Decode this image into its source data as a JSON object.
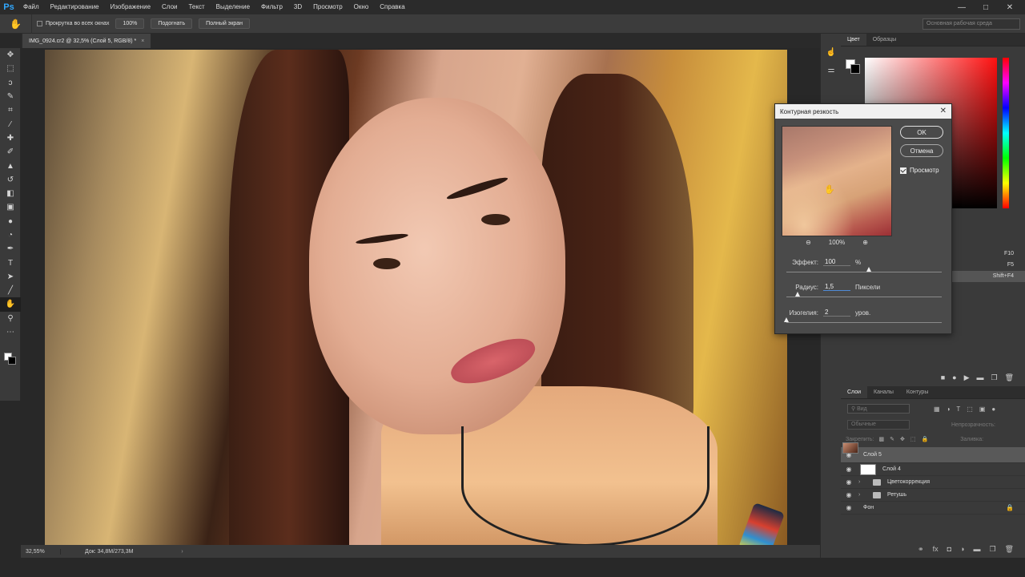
{
  "app": {
    "logo": "Ps"
  },
  "menu": [
    "Файл",
    "Редактирование",
    "Изображение",
    "Слои",
    "Текст",
    "Выделение",
    "Фильтр",
    "3D",
    "Просмотр",
    "Окно",
    "Справка"
  ],
  "window_controls": {
    "minimize": "—",
    "maximize": "□",
    "close": "✕"
  },
  "options_bar": {
    "scroll_all_label": "Прокрутка во всех окнах",
    "zoom_100": "100%",
    "fit_label": "Подогнать",
    "fullscreen_label": "Полный экран",
    "workspace_placeholder": "Основная рабочая среда"
  },
  "document": {
    "tab_title": "IMG_0924.cr2 @ 32,5% (Слой 5, RGB/8) *",
    "tab_close": "×",
    "status_zoom": "32,55%",
    "status_doc": "Док: 34,8M/273,3M",
    "status_arrow": "›"
  },
  "tools": [
    "move",
    "marquee",
    "lasso",
    "quick-select",
    "crop",
    "eyedropper",
    "healing",
    "brush",
    "stamp",
    "history-brush",
    "eraser",
    "gradient",
    "blur",
    "dodge",
    "pen",
    "type",
    "path-select",
    "shape",
    "hand",
    "zoom",
    "more"
  ],
  "color_panel": {
    "tabs": [
      "Цвет",
      "Образцы"
    ]
  },
  "shortcuts": [
    "F10",
    "F5",
    "Shift+F4"
  ],
  "layers_panel": {
    "tabs": [
      "Слои",
      "Каналы",
      "Контуры"
    ],
    "kind_placeholder": "Вид",
    "blend_mode": "Обычные",
    "opacity_label": "Непрозрачность:",
    "lock_label": "Закрепить:",
    "fill_label": "Заливка:",
    "layers": [
      {
        "name": "Слой 5",
        "selected": true,
        "type": "photo"
      },
      {
        "name": "Слой 4",
        "selected": false,
        "type": "masked"
      },
      {
        "name": "Цветокоррекция",
        "selected": false,
        "type": "group"
      },
      {
        "name": "Ретушь",
        "selected": false,
        "type": "group"
      },
      {
        "name": "Фон",
        "selected": false,
        "type": "background"
      }
    ]
  },
  "dialog": {
    "title": "Контурная резкость",
    "close": "✕",
    "ok": "OK",
    "cancel": "Отмена",
    "preview_label": "Просмотр",
    "preview_checked": true,
    "zoom_out": "⊖",
    "zoom_value": "100%",
    "zoom_in": "⊕",
    "amount": {
      "label": "Эффект:",
      "value": "100",
      "unit": "%",
      "slider_fraction": 0.53
    },
    "radius": {
      "label": "Радиус:",
      "value": "1,5",
      "unit": "Пиксели",
      "slider_fraction": 0.07
    },
    "threshold": {
      "label": "Изогелия:",
      "value": "2",
      "unit": "уров.",
      "slider_fraction": 0.0
    }
  }
}
